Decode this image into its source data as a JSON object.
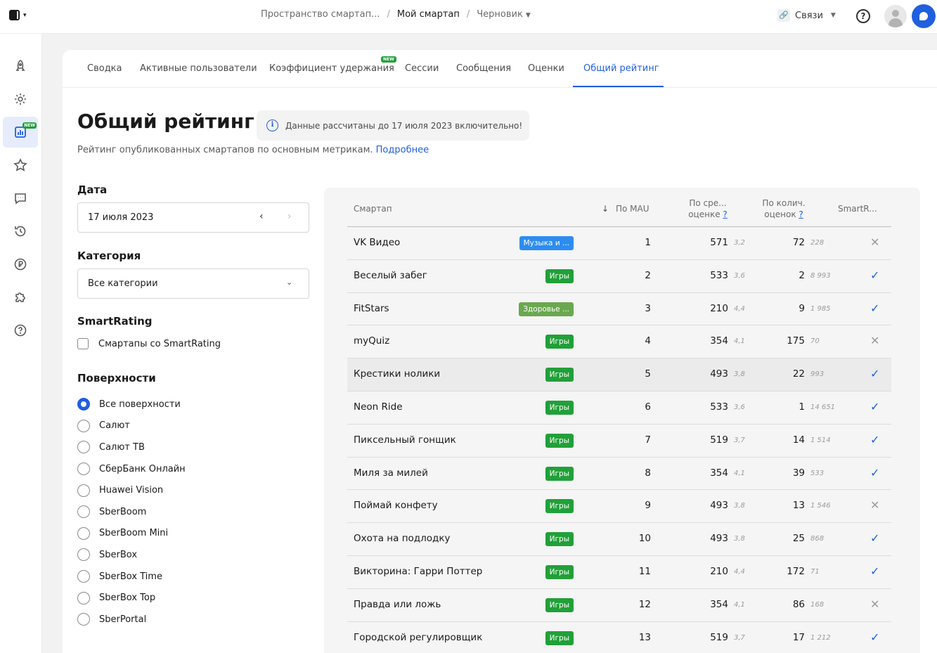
{
  "breadcrumb": {
    "space": "Пространство смартап...",
    "smartapp": "Мой смартап",
    "version": "Черновик"
  },
  "topbar": {
    "links_label": "Связи"
  },
  "tabs": [
    {
      "label": "Сводка"
    },
    {
      "label": "Активные пользователи"
    },
    {
      "label": "Коэффициент удержания"
    },
    {
      "label": "Сессии"
    },
    {
      "label": "Сообщения"
    },
    {
      "label": "Оценки"
    },
    {
      "label": "Общий рейтинг"
    }
  ],
  "new_badge": "NEW",
  "page": {
    "title": "Общий рейтинг",
    "notice": "Данные рассчитаны до 17 июля 2023 включительно!",
    "subtitle": "Рейтинг опубликованных смартапов по основным метрикам.",
    "subtitle_link": "Подробнее"
  },
  "filters": {
    "date_label": "Дата",
    "date_value": "17 июля 2023",
    "category_label": "Категория",
    "category_value": "Все категории",
    "smartrating_label": "SmartRating",
    "smartrating_checkbox": "Смартапы со SmartRating",
    "surfaces_label": "Поверхности",
    "surfaces": [
      "Все поверхности",
      "Салют",
      "Салют ТВ",
      "СберБанк Онлайн",
      "Huawei Vision",
      "SberBoom",
      "SberBoom Mini",
      "SberBox",
      "SberBox Time",
      "SberBox Top",
      "SberPortal"
    ],
    "selected_surface": "Все поверхности"
  },
  "table": {
    "headers": {
      "smartapp": "Смартап",
      "mau": "По MAU",
      "avg_1": "По сре...",
      "avg_2": "оценке",
      "count_1": "По колич.",
      "count_2": "оценок",
      "help": "?",
      "smartrating": "SmartR..."
    },
    "rows": [
      {
        "name": "VK Видео",
        "category": "Музыка и ...",
        "cat_color": "#2d8cf0",
        "mau": "1",
        "avg_rank": "571",
        "avg": "3,2",
        "count_rank": "72",
        "count": "228",
        "smartrating": false
      },
      {
        "name": "Веселый забег",
        "category": "Игры",
        "cat_color": "#21a038",
        "mau": "2",
        "avg_rank": "533",
        "avg": "3,6",
        "count_rank": "2",
        "count": "8 993",
        "smartrating": true
      },
      {
        "name": "FitStars",
        "category": "Здоровье ...",
        "cat_color": "#6aa84f",
        "mau": "3",
        "avg_rank": "210",
        "avg": "4,4",
        "count_rank": "9",
        "count": "1 985",
        "smartrating": true
      },
      {
        "name": "myQuiz",
        "category": "Игры",
        "cat_color": "#21a038",
        "mau": "4",
        "avg_rank": "354",
        "avg": "4,1",
        "count_rank": "175",
        "count": "70",
        "smartrating": false
      },
      {
        "name": "Крестики нолики",
        "category": "Игры",
        "cat_color": "#21a038",
        "mau": "5",
        "avg_rank": "493",
        "avg": "3,8",
        "count_rank": "22",
        "count": "993",
        "smartrating": true
      },
      {
        "name": "Neon Ride",
        "category": "Игры",
        "cat_color": "#21a038",
        "mau": "6",
        "avg_rank": "533",
        "avg": "3,6",
        "count_rank": "1",
        "count": "14 651",
        "smartrating": true
      },
      {
        "name": "Пиксельный гонщик",
        "category": "Игры",
        "cat_color": "#21a038",
        "mau": "7",
        "avg_rank": "519",
        "avg": "3,7",
        "count_rank": "14",
        "count": "1 514",
        "smartrating": true
      },
      {
        "name": "Миля за милей",
        "category": "Игры",
        "cat_color": "#21a038",
        "mau": "8",
        "avg_rank": "354",
        "avg": "4,1",
        "count_rank": "39",
        "count": "533",
        "smartrating": true
      },
      {
        "name": "Поймай конфету",
        "category": "Игры",
        "cat_color": "#21a038",
        "mau": "9",
        "avg_rank": "493",
        "avg": "3,8",
        "count_rank": "13",
        "count": "1 546",
        "smartrating": false
      },
      {
        "name": "Охота на подлодку",
        "category": "Игры",
        "cat_color": "#21a038",
        "mau": "10",
        "avg_rank": "493",
        "avg": "3,8",
        "count_rank": "25",
        "count": "868",
        "smartrating": true
      },
      {
        "name": "Викторина: Гарри Поттер",
        "category": "Игры",
        "cat_color": "#21a038",
        "mau": "11",
        "avg_rank": "210",
        "avg": "4,4",
        "count_rank": "172",
        "count": "71",
        "smartrating": true
      },
      {
        "name": "Правда или ложь",
        "category": "Игры",
        "cat_color": "#21a038",
        "mau": "12",
        "avg_rank": "354",
        "avg": "4,1",
        "count_rank": "86",
        "count": "168",
        "smartrating": false
      },
      {
        "name": "Городской регулировщик",
        "category": "Игры",
        "cat_color": "#21a038",
        "mau": "13",
        "avg_rank": "519",
        "avg": "3,7",
        "count_rank": "17",
        "count": "1 212",
        "smartrating": true
      }
    ]
  }
}
